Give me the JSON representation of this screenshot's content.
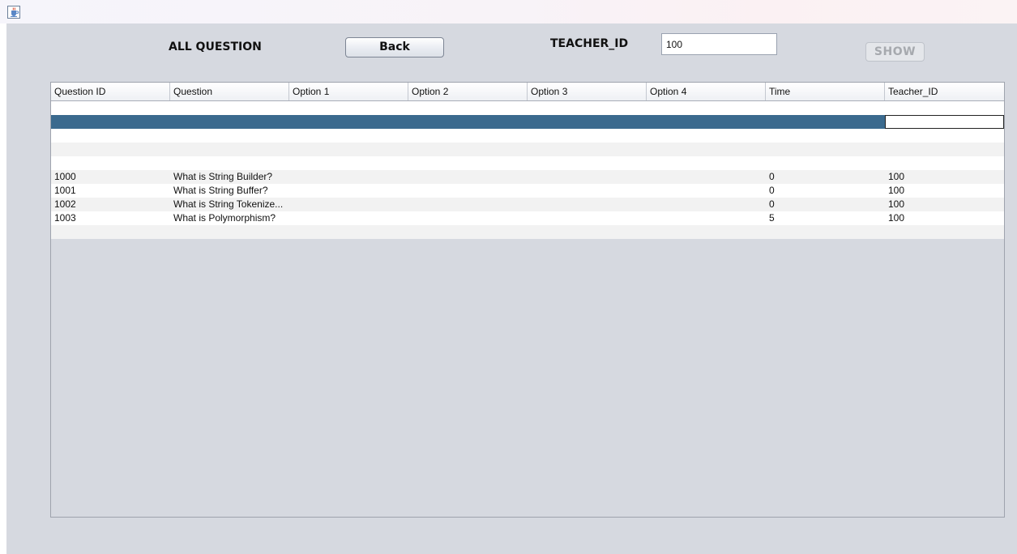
{
  "window": {
    "icon": "java-cup-icon"
  },
  "header": {
    "title": "ALL QUESTION",
    "back_label": "Back",
    "teacher_label": "TEACHER_ID",
    "teacher_value": "100",
    "show_label": "SHOW"
  },
  "table": {
    "columns": [
      "Question ID",
      "Question",
      "Option 1",
      "Option 2",
      "Option 3",
      "Option 4",
      "Time",
      "Teacher_ID"
    ],
    "rows": [
      [
        "",
        "",
        "",
        "",
        "",
        "",
        "",
        ""
      ],
      [
        "",
        "",
        "",
        "",
        "",
        "",
        "",
        ""
      ],
      [
        "",
        "",
        "",
        "",
        "",
        "",
        "",
        ""
      ],
      [
        "",
        "",
        "",
        "",
        "",
        "",
        "",
        ""
      ],
      [
        "",
        "",
        "",
        "",
        "",
        "",
        "",
        ""
      ],
      [
        "1000",
        "What is String Builder?",
        "",
        "",
        "",
        "",
        "0",
        "100"
      ],
      [
        "1001",
        "What is String Buffer?",
        "",
        "",
        "",
        "",
        "0",
        "100"
      ],
      [
        "1002",
        "What is String Tokenize...",
        "",
        "",
        "",
        "",
        "0",
        "100"
      ],
      [
        "1003",
        "What is Polymorphism?",
        "",
        "",
        "",
        "",
        "5",
        "100"
      ],
      [
        "",
        "",
        "",
        "",
        "",
        "",
        "",
        ""
      ]
    ],
    "selected_row": 1,
    "selection_color": "#3b6a8e"
  }
}
